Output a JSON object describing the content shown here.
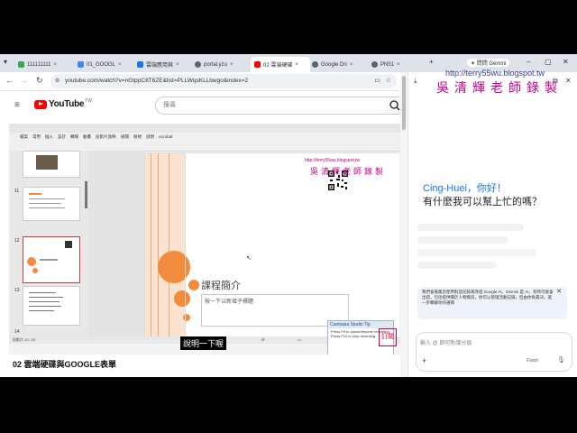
{
  "browser": {
    "tabs": [
      {
        "label": "111111111",
        "color": "#34a853"
      },
      {
        "label": "01_GOOGL",
        "color": "#4285f4"
      },
      {
        "label": "雲端應用與",
        "color": "#1a73e8"
      },
      {
        "label": "portal.yzu",
        "color": "#5f6368"
      },
      {
        "label": "02 雲端硬碟",
        "color": "#ff0000"
      },
      {
        "label": "Google Dri",
        "color": "#5f6368"
      },
      {
        "label": "PN51",
        "color": "#5f6368"
      }
    ],
    "new_tab": "+",
    "url": "youtube.com/watch?v=nGtppC8T6ZE&list=PLLWqsKLLbwgo&index=2",
    "gemini_button": "✦ 問問 Gemini"
  },
  "youtube": {
    "logo": "YouTube",
    "region": "TW",
    "search_placeholder": "搜尋",
    "video_title": "02 雲端硬碟與GOOGLE表單",
    "caption": "說明一下喔"
  },
  "slide": {
    "title": "課程簡介",
    "subtitle_text": "按一下以新增子標題",
    "slide_numbers": [
      "11",
      "12",
      "13",
      "14"
    ],
    "status": "投影片 12 / 20",
    "zoom": "82%"
  },
  "ppt_menu": [
    "檔案",
    "常用",
    "插入",
    "設計",
    "轉場",
    "動畫",
    "投影片放映",
    "檢閱",
    "檢視",
    "說明",
    "Acrobat"
  ],
  "camtasia": {
    "header": "Camtasia Studio Tip",
    "body": "Press F9 to pause/resume recording. Press F10 to stop recording."
  },
  "watermark": {
    "url": "http://terry55wu.blogspot.tw",
    "name": "吳清輝老師錄製",
    "subscribe": "訂閱"
  },
  "gemini": {
    "greeting_name": "Cing-Huei，你好！",
    "greeting_question": "有什麼我可以幫上忙的嗎？",
    "notice": "我們會蒐集您使用對話記錄來改進 Google AI。Gemini 是 AI，有時可能會出錯，包括提供關於人物資訊，你可以管理活動記錄，但由你負責決。進一步瞭解你的選擇",
    "input_placeholder": "輸入 @ 即可新增分頁",
    "model": "Flash"
  }
}
